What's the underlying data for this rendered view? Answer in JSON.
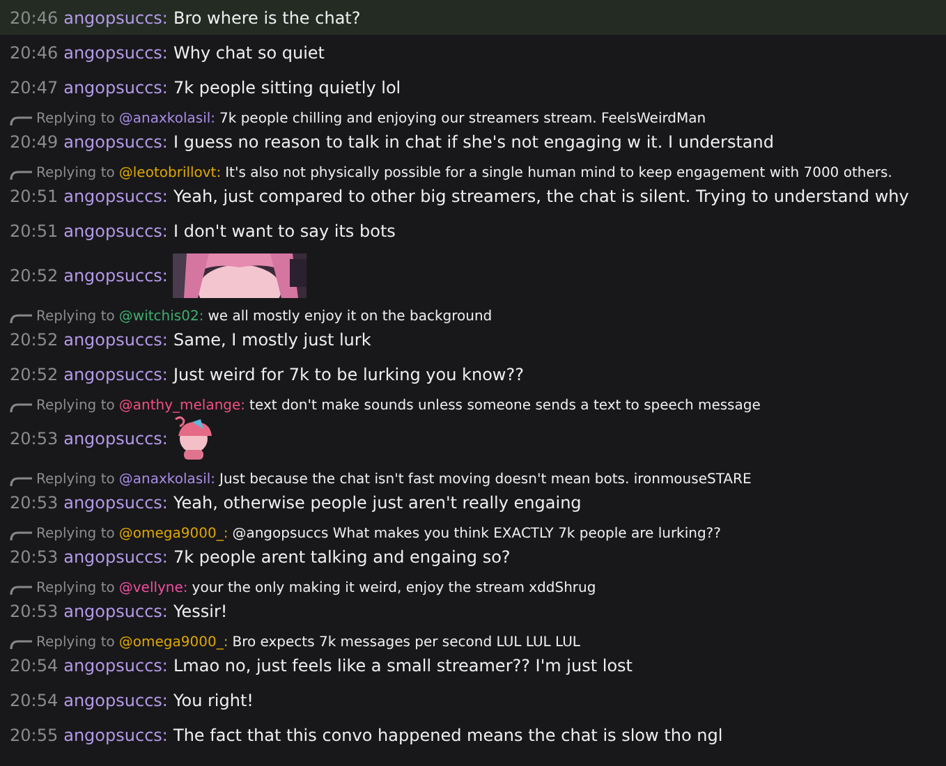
{
  "messages": [
    {
      "time": "20:46",
      "user": "angopsuccs:",
      "text": "Bro where is the chat?",
      "highlighted": true
    },
    {
      "time": "20:46",
      "user": "angopsuccs:",
      "text": "Why chat so quiet",
      "highlighted": false
    },
    {
      "time": "20:47",
      "user": "angopsuccs:",
      "text": "7k people sitting quietly lol",
      "highlighted": false
    },
    {
      "time": "20:49",
      "user": "angopsuccs:",
      "text": "I guess no reason to talk in chat if she's not engaging w it. I understand",
      "highlighted": false,
      "reply": {
        "prefix": "Replying to",
        "to": "@anaxkolasil:",
        "color": "#a98ce6",
        "text": "7k people chilling and enjoying our streamers stream. FeelsWeirdMan"
      }
    },
    {
      "time": "20:51",
      "user": "angopsuccs:",
      "text": "Yeah, just compared to other big streamers, the chat is silent. Trying to understand why",
      "highlighted": false,
      "reply": {
        "prefix": "Replying to",
        "to": "@leotobrillovt:",
        "color": "#e0a800",
        "text": "It's also not physically possible for a single human mind to keep engagement with 7000 others."
      }
    },
    {
      "time": "20:51",
      "user": "angopsuccs:",
      "text": "I don't want to say its bots",
      "highlighted": false
    },
    {
      "time": "20:52",
      "user": "angopsuccs:",
      "highlighted": false
    },
    {
      "time": "20:52",
      "user": "angopsuccs:",
      "text": "Same, I mostly just lurk",
      "highlighted": false,
      "reply": {
        "prefix": "Replying to",
        "to": "@witchis02:",
        "color": "#3fae6e",
        "text": "we all mostly enjoy it on the background"
      }
    },
    {
      "time": "20:52",
      "user": "angopsuccs:",
      "text": "Just weird for 7k to be lurking you know??",
      "highlighted": false
    },
    {
      "time": "20:53",
      "user": "angopsuccs:",
      "highlighted": false,
      "reply": {
        "prefix": "Replying to",
        "to": "@anthy_melange:",
        "color": "#f2507e",
        "text": "text don't make sounds unless someone sends a text to speech message"
      }
    },
    {
      "time": "20:53",
      "user": "angopsuccs:",
      "text": "Yeah, otherwise people just aren't really engaing",
      "highlighted": false,
      "reply": {
        "prefix": "Replying to",
        "to": "@anaxkolasil:",
        "color": "#a98ce6",
        "text": "Just because the chat isn't fast moving doesn't mean bots. ironmouseSTARE"
      }
    },
    {
      "time": "20:53",
      "user": "angopsuccs:",
      "text": "7k people arent talking and engaing so?",
      "highlighted": false,
      "reply": {
        "prefix": "Replying to",
        "to": "@omega9000_:",
        "color": "#e0a800",
        "text": "@angopsuccs What makes you think EXACTLY 7k people are lurking??"
      }
    },
    {
      "time": "20:53",
      "user": "angopsuccs:",
      "text": "Yessir!",
      "highlighted": false,
      "reply": {
        "prefix": "Replying to",
        "to": "@vellyne:",
        "color": "#f04fa0",
        "text": "your the only making it weird, enjoy the stream xddShrug"
      }
    },
    {
      "time": "20:54",
      "user": "angopsuccs:",
      "text": "Lmao no, just feels like a small streamer?? I'm just lost",
      "highlighted": false,
      "reply": {
        "prefix": "Replying to",
        "to": "@omega9000_:",
        "color": "#e0a800",
        "text": "Bro expects 7k messages per second LUL LUL LUL"
      }
    },
    {
      "time": "20:54",
      "user": "angopsuccs:",
      "text": "You right!",
      "highlighted": false
    },
    {
      "time": "20:55",
      "user": "angopsuccs:",
      "text": "The fact that this convo happened means the chat is slow tho ngl",
      "highlighted": false
    }
  ]
}
